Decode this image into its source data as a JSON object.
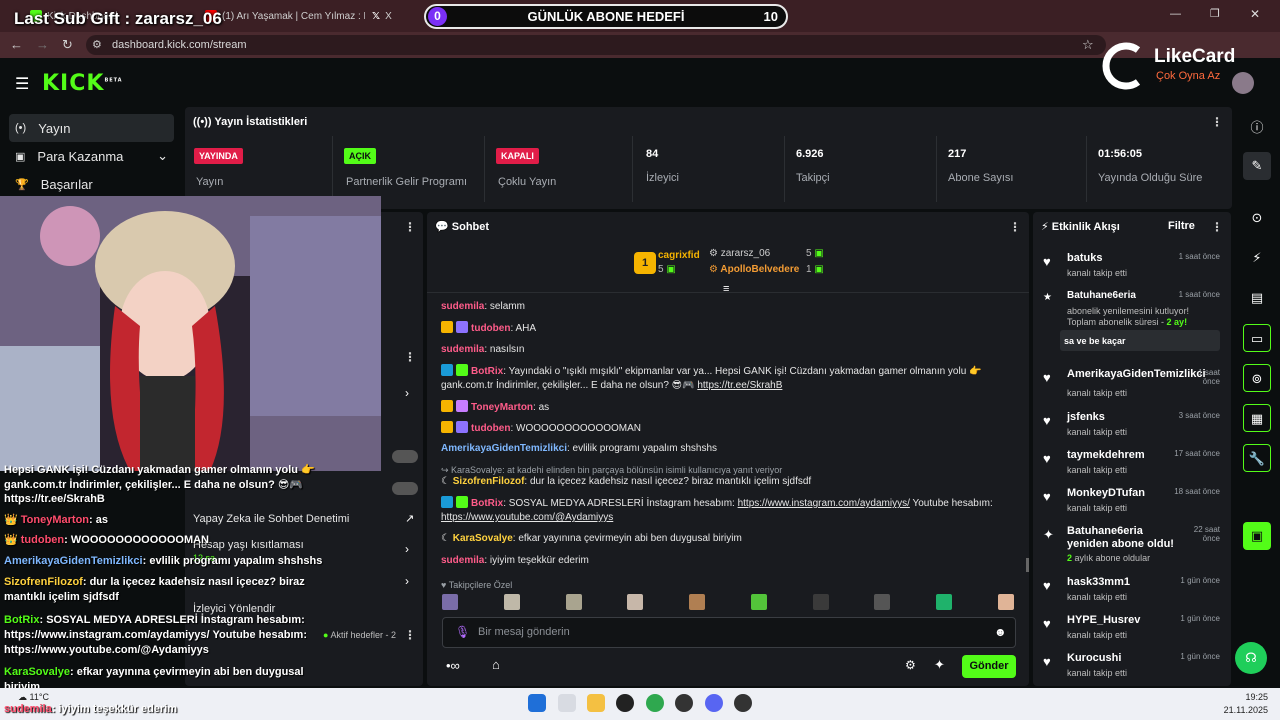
{
  "browser": {
    "tabs": [
      {
        "label": "Kick Dashboard"
      },
      {
        "label": "(1) Arı Yaşamak | Cem Yılmaz : Du"
      },
      {
        "label": "X"
      }
    ],
    "url": "dashboard.kick.com/stream"
  },
  "overlay": {
    "last_sub": "Last Sub Gift : zararsz_06",
    "goal_current": "0",
    "goal_title": "GÜNLÜK ABONE HEDEFİ",
    "goal_target": "10",
    "likecard_name": "LikeCard",
    "likecard_slogan": "Çok Oyna  Az"
  },
  "kick": {
    "logo": "KICK",
    "logo_sup": "BETA"
  },
  "sidebar": {
    "items": [
      {
        "label": "Yayın",
        "icon": "broadcast-icon"
      },
      {
        "label": "Para Kazanma",
        "icon": "money-icon"
      },
      {
        "label": "Başarılar",
        "icon": "trophy-icon"
      }
    ]
  },
  "stats": {
    "title": "Yayın İstatistikleri",
    "cells": [
      {
        "badge": "YAYINDA",
        "label": "Yayın",
        "badge_color": "#e11d48"
      },
      {
        "badge": "AÇIK",
        "label": "Partnerlik Gelir Programı",
        "badge_color": "#53fc18"
      },
      {
        "badge": "KAPALI",
        "label": "Çoklu Yayın",
        "badge_color": "#e11d48"
      },
      {
        "value": "84",
        "label": "İzleyici"
      },
      {
        "value": "6.926",
        "label": "Takipçi"
      },
      {
        "value": "217",
        "label": "Abone Sayısı"
      },
      {
        "value": "01:56:05",
        "label": "Yayında Olduğu Süre"
      }
    ]
  },
  "mid_panel": {
    "items": [
      {
        "label": "Yapay Zeka ile Sohbet Denetimi"
      },
      {
        "label": "Hesap yaşı kısıtlaması"
      },
      {
        "label": "İzleyici Yönlendir"
      }
    ],
    "active_goals": "Aktif hedefler - 2",
    "duration": "12 sa"
  },
  "chat": {
    "title": "Sohbet",
    "top_gifters": [
      {
        "rank": "1",
        "name": "cagrixfid",
        "count": "5"
      },
      {
        "name": "zararsz_06",
        "count": "5"
      },
      {
        "name": "ApolloBelvedere",
        "count": "1"
      }
    ],
    "messages": [
      {
        "user": "sudemila",
        "text": "selamm",
        "color": "#ff5c8a"
      },
      {
        "user": "tudoben",
        "text": "AHA",
        "color": "#ff5c8a"
      },
      {
        "user": "sudemila",
        "text": "nasılsın",
        "color": "#ff5c8a"
      },
      {
        "user": "BotRix",
        "text": "Yayındaki o \"ışıklı mışıklı\" ekipmanlar var ya... Hepsi GANK işi! Cüzdanı yakmadan gamer olmanın yolu 👉",
        "text2": "gank.com.tr İndirimler, çekilişler... E daha ne olsun? 😎🎮 ",
        "link": "https://tr.ee/SkrahB",
        "color": "#ff5c8a"
      },
      {
        "user": "ToneyMarton",
        "text": "as",
        "color": "#ff5c8a"
      },
      {
        "user": "tudoben",
        "text": "WOOOOOOOOOOOOMAN",
        "color": "#ff5c8a"
      },
      {
        "user": "AmerikayaGidenTemizlikci",
        "text": "evlilik programı yapalım shshshs",
        "color": "#7fb8ff"
      },
      {
        "reply": "KaraSovalye: at kadehi elinden bin parçaya bölünsün isimli kullanıcıya yanıt veriyor"
      },
      {
        "user": "SizofrenFilozof",
        "text": "dur la içecez kadehsiz nasıl içecez? biraz mantıklı içelim sjdfsdf",
        "color": "#ffd23f"
      },
      {
        "user": "BotRix",
        "text": "SOSYAL MEDYA ADRESLERİ İnstagram hesabım: ",
        "link": "https://www.instagram.com/aydamiyys/",
        "text2": " Youtube hesabım:",
        "link2": "https://www.youtube.com/@Aydamiyys",
        "color": "#ff5c8a"
      },
      {
        "user": "KaraSovalye",
        "text": "efkar yayınına çevirmeyin abi ben duygusal biriyim",
        "color": "#ffd23f"
      },
      {
        "user": "sudemila",
        "text": "iyiyim teşekkür ederim",
        "color": "#ff5c8a"
      }
    ],
    "followers_only": "Takipçilere Özel",
    "input_placeholder": "Bir mesaj gönderin",
    "send_label": "Gönder"
  },
  "events": {
    "title": "Etkinlik Akışı",
    "filter": "Filtre",
    "items": [
      {
        "name": "batuks",
        "sub": "kanalı takip etti",
        "time": "1 saat önce",
        "icon": "heart-icon"
      },
      {
        "name": "Batuhane6eria",
        "sub": "abonelik yenilemesini kutluyor!",
        "sub2": "Toplam abonelik süresi - ",
        "sub2b": "2 ay!",
        "time": "1 saat önce",
        "message": "sa ve be kaçar",
        "icon": "star-icon"
      },
      {
        "name": "AmerikayaGidenTemizlikci",
        "sub": "kanalı takip etti",
        "time": "1 saat önce",
        "icon": "heart-icon"
      },
      {
        "name": "jsfenks",
        "sub": "kanalı takip etti",
        "time": "3 saat önce",
        "icon": "heart-icon"
      },
      {
        "name": "taymekdehrem",
        "sub": "kanalı takip etti",
        "time": "17 saat önce",
        "icon": "heart-icon"
      },
      {
        "name": "MonkeyDTufan",
        "sub": "kanalı takip etti",
        "time": "18 saat önce",
        "icon": "heart-icon"
      },
      {
        "name": "Batuhane6eria yeniden abone oldu!",
        "sub": "2",
        "subb": " aylık abone oldular",
        "time": "22 saat önce",
        "icon": "sparkle-icon"
      },
      {
        "name": "hask33mm1",
        "sub": "kanalı takip etti",
        "time": "1 gün önce",
        "icon": "heart-icon"
      },
      {
        "name": "HYPE_Husrev",
        "sub": "kanalı takip etti",
        "time": "1 gün önce",
        "icon": "heart-icon"
      },
      {
        "name": "Kurocushi",
        "sub": "kanalı takip etti",
        "time": "1 gün önce",
        "icon": "heart-icon"
      }
    ]
  },
  "overlay_chat": [
    {
      "user": "",
      "text": "Hepsi GANK işi! Cüzdanı yakmadan gamer olmanın yolu 👉"
    },
    {
      "user": "",
      "text": "gank.com.tr İndirimler, çekilişler... E daha ne olsun? 😎🎮"
    },
    {
      "user": "",
      "text": "https://tr.ee/SkrahB"
    },
    {
      "user": "ToneyMarton",
      "text": "as",
      "color": "#ff4d6d"
    },
    {
      "user": "tudoben",
      "text": "WOOOOOOOOOOOOMAN",
      "color": "#ff4d6d"
    },
    {
      "user": "AmerikayaGidenTemizlikci",
      "text": "evlilik programı yapalım shshshs",
      "color": "#7fb8ff"
    },
    {
      "user": "SizofrenFilozof",
      "text": "dur la içecez kadehsiz nasıl içecez? biraz",
      "color": "#ffd23f"
    },
    {
      "user": "",
      "text": "mantıklı içelim sjdfsdf"
    },
    {
      "user": "BotRix",
      "text": "SOSYAL MEDYA ADRESLERİ İnstagram hesabım:",
      "color": "#53fc18"
    },
    {
      "user": "",
      "text": "https://www.instagram.com/aydamiyys/ Youtube hesabım:"
    },
    {
      "user": "",
      "text": "https://www.youtube.com/@Aydamiyys"
    },
    {
      "user": "KaraSovalye",
      "text": "efkar yayınına çevirmeyin abi ben duygusal",
      "color": "#53fc18"
    },
    {
      "user": "",
      "text": "biriyim"
    },
    {
      "user": "sudemila",
      "text": "iyiyim teşekkür ederim",
      "color": "#ff4d6d"
    }
  ],
  "taskbar": {
    "weather": "11°C",
    "time": "19:25",
    "date": "21.11.2025"
  }
}
